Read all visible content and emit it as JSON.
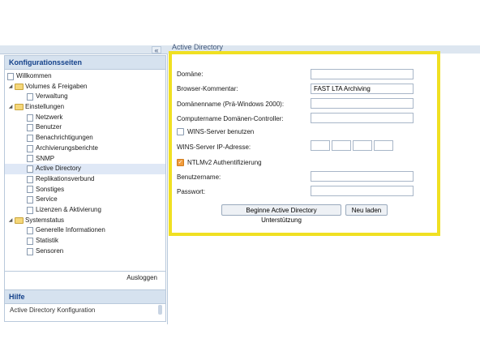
{
  "top_title": "Active Directory",
  "collapse_glyph": "«",
  "sidebar": {
    "header": "Konfigurationsseiten",
    "items": [
      {
        "label": "Willkommen",
        "level": 1,
        "icon": "page-icon"
      },
      {
        "label": "Volumes & Freigaben",
        "level": 1,
        "icon": "folder-icon"
      },
      {
        "label": "Verwaltung",
        "level": 2,
        "icon": "page-icon"
      },
      {
        "label": "Einstellungen",
        "level": 1,
        "icon": "folder-icon"
      },
      {
        "label": "Netzwerk",
        "level": 2,
        "icon": "page-icon"
      },
      {
        "label": "Benutzer",
        "level": 2,
        "icon": "page-icon"
      },
      {
        "label": "Benachrichtigungen",
        "level": 2,
        "icon": "page-icon"
      },
      {
        "label": "Archivierungsberichte",
        "level": 2,
        "icon": "page-icon"
      },
      {
        "label": "SNMP",
        "level": 2,
        "icon": "page-icon"
      },
      {
        "label": "Active Directory",
        "level": 2,
        "icon": "page-icon",
        "selected": true
      },
      {
        "label": "Replikationsverbund",
        "level": 2,
        "icon": "page-icon"
      },
      {
        "label": "Sonstiges",
        "level": 2,
        "icon": "page-icon"
      },
      {
        "label": "Service",
        "level": 2,
        "icon": "page-icon"
      },
      {
        "label": "Lizenzen & Aktivierung",
        "level": 2,
        "icon": "page-icon"
      },
      {
        "label": "Systemstatus",
        "level": 1,
        "icon": "folder-icon"
      },
      {
        "label": "Generelle Informationen",
        "level": 2,
        "icon": "page-icon"
      },
      {
        "label": "Statistik",
        "level": 2,
        "icon": "page-icon"
      },
      {
        "label": "Sensoren",
        "level": 2,
        "icon": "page-icon"
      }
    ],
    "logout_label": "Ausloggen"
  },
  "help": {
    "header": "Hilfe",
    "text": "Active Directory Konfiguration"
  },
  "form": {
    "domain_label": "Domäne:",
    "domain_value": "",
    "browser_comment_label": "Browser-Kommentar:",
    "browser_comment_value": "FAST LTA Archiving",
    "netbios_label": "Domänenname (Prä-Windows 2000):",
    "netbios_value": "",
    "dc_label": "Computername Domänen-Controller:",
    "dc_value": "",
    "wins_use_label": "WINS-Server benutzen",
    "wins_use_checked": false,
    "wins_ip_label": "WINS-Server IP-Adresse:",
    "ntlm_label": "NTLMv2 Authentifizierung",
    "ntlm_checked": true,
    "username_label": "Benutzername:",
    "username_value": "",
    "password_label": "Passwort:",
    "password_value": ""
  },
  "buttons": {
    "start_label": "Beginne Active Directory Unterstützung",
    "reload_label": "Neu laden"
  },
  "colors": {
    "highlight": "#f0e022",
    "header_blue": "#15428b",
    "checkbox_checked": "#f29c3b"
  }
}
